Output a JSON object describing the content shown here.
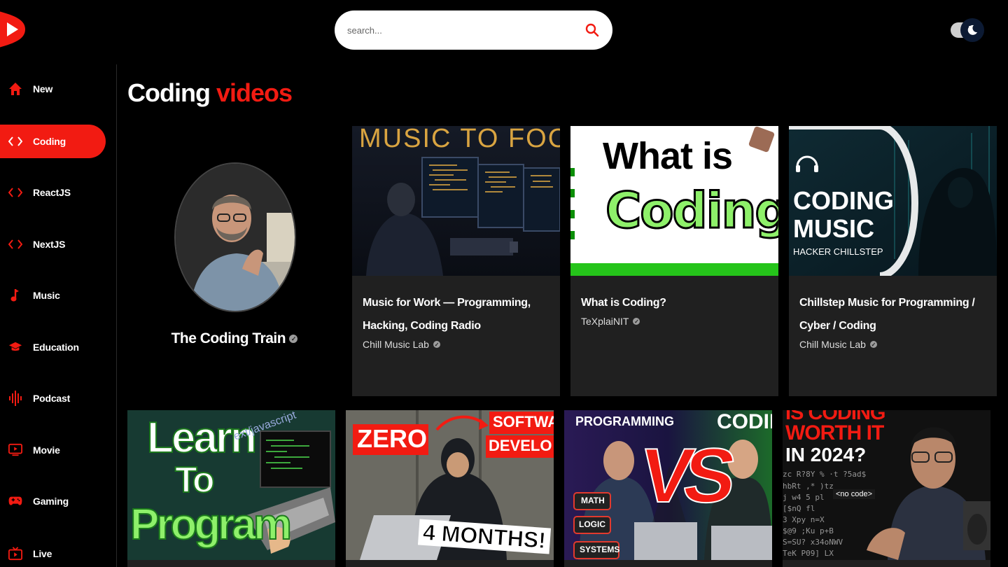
{
  "search": {
    "placeholder": "search..."
  },
  "sidebar": {
    "items": [
      {
        "label": "New",
        "icon": "home-icon"
      },
      {
        "label": "Coding",
        "icon": "code-icon",
        "active": true
      },
      {
        "label": "ReactJS",
        "icon": "code-icon"
      },
      {
        "label": "NextJS",
        "icon": "code-icon"
      },
      {
        "label": "Music",
        "icon": "music-note-icon"
      },
      {
        "label": "Education",
        "icon": "graduation-cap-icon"
      },
      {
        "label": "Podcast",
        "icon": "podcast-icon"
      },
      {
        "label": "Movie",
        "icon": "tv-icon"
      },
      {
        "label": "Gaming",
        "icon": "gamepad-icon"
      },
      {
        "label": "Live",
        "icon": "live-tv-icon"
      }
    ]
  },
  "main": {
    "title_main": "Coding",
    "title_accent": "videos",
    "channel": {
      "name": "The Coding Train"
    },
    "videos": [
      {
        "title": "Music for Work — Programming, Hacking, Coding Radio",
        "channel": "Chill Music Lab",
        "thumb_text": "MUSIC TO FOCU"
      },
      {
        "title": "What is Coding?",
        "channel": "TeXplaiNIT",
        "thumb_text_1": "What is",
        "thumb_text_2": "Coding?"
      },
      {
        "title": "Chillstep Music for Programming / Cyber / Coding",
        "channel": "Chill Music Lab",
        "thumb_text_1": "CODING",
        "thumb_text_2": "MUSIC",
        "thumb_text_3": "HACKER CHILLSTEP"
      },
      {
        "thumb_text_1": "Learn",
        "thumb_text_2": "To",
        "thumb_text_3": "Program",
        "thumb_text_4": "ext/javascript"
      },
      {
        "thumb_text_1": "ZERO",
        "thumb_text_2": "SOFTWA",
        "thumb_text_3": "DEVELO",
        "thumb_text_4": "4 MONTHS!"
      },
      {
        "thumb_text_1": "PROGRAMMING",
        "thumb_text_2": "CODIN",
        "thumb_text_3": "VS",
        "tags": [
          "MATH",
          "LOGIC",
          "SYSTEMS"
        ]
      },
      {
        "thumb_text_1": "IS CODING",
        "thumb_text_2": "WORTH IT",
        "thumb_text_3": "IN 2024?",
        "thumb_text_4": "<no code>"
      }
    ]
  },
  "colors": {
    "accent": "#f21b12",
    "card_bg": "#202020",
    "background": "#000000"
  }
}
